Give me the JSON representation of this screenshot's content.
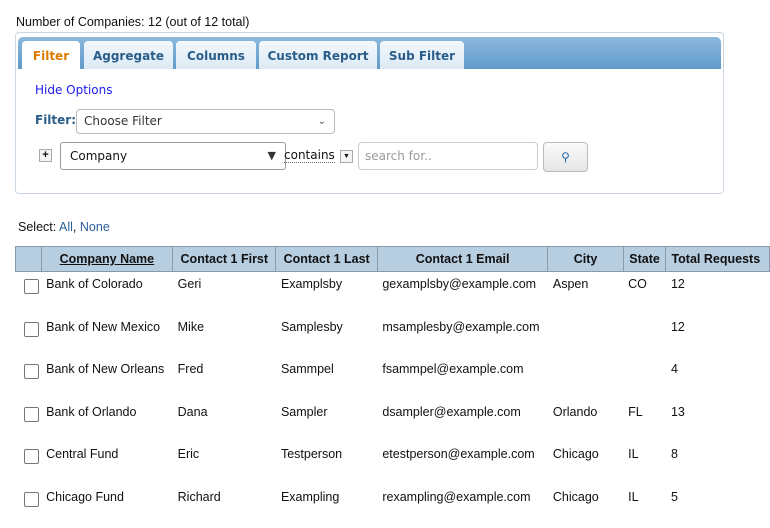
{
  "summary": "Number of Companies: 12 (out of 12 total)",
  "tabs": [
    "Filter",
    "Aggregate",
    "Columns",
    "Custom Report",
    "Sub Filter"
  ],
  "hide_options": "Hide Options",
  "filter_label": "Filter:",
  "filter_select": "Choose Filter",
  "field_select": "Company",
  "operator": "contains",
  "search_placeholder": "search for..",
  "select": {
    "label": "Select:",
    "all": "All",
    "sep": ",",
    "none": "None"
  },
  "columns": [
    "Company Name",
    "Contact 1 First",
    "Contact 1 Last",
    "Contact 1 Email",
    "City",
    "State",
    "Total Requests"
  ],
  "rows": [
    [
      "Bank of Colorado",
      "Geri",
      "Examplsby",
      "gexamplsby@example.com",
      "Aspen",
      "CO",
      "12"
    ],
    [
      "Bank of New Mexico",
      "Mike",
      "Samplesby",
      "msamplesby@example.com",
      "",
      "",
      "12"
    ],
    [
      "Bank of New Orleans",
      "Fred",
      "Sammpel",
      "fsammpel@example.com",
      "",
      "",
      "4"
    ],
    [
      "Bank of Orlando",
      "Dana",
      "Sampler",
      "dsampler@example.com",
      "Orlando",
      "FL",
      "13"
    ],
    [
      "Central Fund",
      "Eric",
      "Testperson",
      "etestperson@example.com",
      "Chicago",
      "IL",
      "8"
    ],
    [
      "Chicago Fund",
      "Richard",
      "Exampling",
      "rexampling@example.com",
      "Chicago",
      "IL",
      "5"
    ]
  ]
}
